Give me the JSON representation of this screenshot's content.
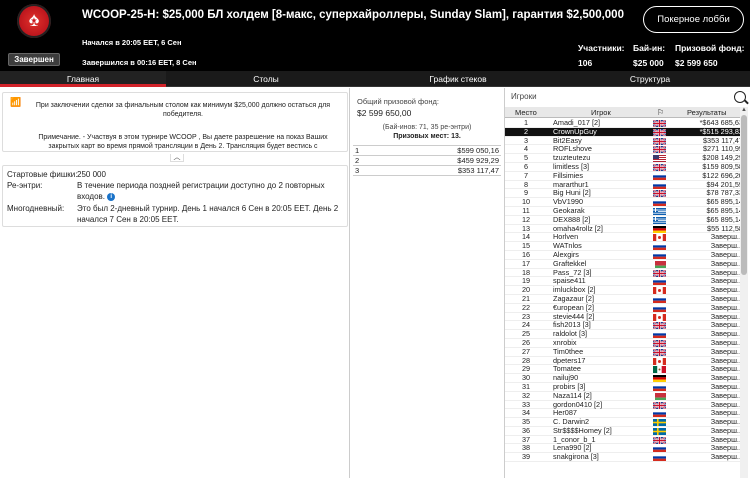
{
  "header": {
    "title": "WCOOP-25-H: $25,000 БЛ холдем [8-макс, суперхайроллеры, Sunday Slam], гарантия $2,500,000",
    "status": "Завершен",
    "started": "Начался в 20:05 EET, 6 Сен",
    "ended": "Завершился в 00:16 EET, 8 Сен",
    "lobby_button": "Покерное лобби",
    "stats": {
      "participants_label": "Участники:",
      "participants_value": "106",
      "buyin_label": "Бай-ин:",
      "buyin_value": "$25 000",
      "prize_label": "Призовой фонд:",
      "prize_value": "$2 599 650"
    }
  },
  "tabs": [
    "Главная",
    "Столы",
    "График стеков",
    "Структура"
  ],
  "notice": {
    "line1": "При заключении сделки за финальным столом как минимум $25,000 должно остаться для победителя.",
    "line2": "Примечание. - Участвуя в этом турнире WCOOP , Вы даете разрешение на показ Ваших закрытых карт во время прямой трансляции в День 2. Трансляция будет вестись с"
  },
  "info": {
    "chips_label": "Стартовые фишки:",
    "chips_value": "250 000",
    "reentry_label": "Ре-энтри:",
    "reentry_value": "В течение периода поздней регистрации доступно до 2 повторных входов.",
    "multiday_label": "Многодневный:",
    "multiday_value": "Это был 2-дневный турнир. День 1 начался 6 Сен в 20:05 EET. День 2 начался 7 Сен в 20:05 EET."
  },
  "prize": {
    "pool_label": "Общий призовой фонд:",
    "pool_value": "$2 599 650,00",
    "buyins_note": "(Бай-инов: 71, 35 ре-энтри)",
    "places_note": "Призовых мест: 13.",
    "rows": [
      {
        "place": "1",
        "amount": "$599 050,16"
      },
      {
        "place": "2",
        "amount": "$459 929,29"
      },
      {
        "place": "3",
        "amount": "$353 117,47"
      }
    ]
  },
  "players": {
    "label": "Игроки",
    "headers": {
      "place": "Место",
      "player": "Игрок",
      "results": "Результаты"
    },
    "rows": [
      {
        "place": "1",
        "name": "Amadi_017 [2]",
        "result": "*$643 685,63",
        "flag": "gb"
      },
      {
        "place": "2",
        "name": "CrownUpGuy",
        "result": "*$515 293,82",
        "flag": "gb"
      },
      {
        "place": "3",
        "name": "Bit2Easy",
        "result": "$353 117,47",
        "flag": "gb"
      },
      {
        "place": "4",
        "name": "ROFLshove",
        "result": "$271 110,99",
        "flag": "gb"
      },
      {
        "place": "5",
        "name": "tzuzteutezu",
        "result": "$208 149,29",
        "flag": "us"
      },
      {
        "place": "6",
        "name": "limitless [3]",
        "result": "$159 809,58",
        "flag": "gb"
      },
      {
        "place": "7",
        "name": "Fillsimies",
        "result": "$122 696,20",
        "flag": "ru"
      },
      {
        "place": "8",
        "name": "mararthur1",
        "result": "$94 201,59",
        "flag": "ru"
      },
      {
        "place": "9",
        "name": "Big Huni [2]",
        "result": "$78 787,33",
        "flag": "gb"
      },
      {
        "place": "10",
        "name": "VbV1990",
        "result": "$65 895,14",
        "flag": "ru"
      },
      {
        "place": "11",
        "name": "Geokarak",
        "result": "$65 895,14",
        "flag": "gr"
      },
      {
        "place": "12",
        "name": "DEX888 [2]",
        "result": "$65 895,14",
        "flag": "gr"
      },
      {
        "place": "13",
        "name": "omaha4rollz [2]",
        "result": "$55 112,58",
        "flag": "de"
      },
      {
        "place": "14",
        "name": "Horlven",
        "result": "Заверш...",
        "flag": "ca"
      },
      {
        "place": "15",
        "name": "WATnlos",
        "result": "Заверш...",
        "flag": "ru"
      },
      {
        "place": "16",
        "name": "Alexgirs",
        "result": "Заверш...",
        "flag": "ru"
      },
      {
        "place": "17",
        "name": "Graftekkel",
        "result": "Заверш...",
        "flag": "by"
      },
      {
        "place": "18",
        "name": "Pass_72 [3]",
        "result": "Заверш...",
        "flag": "gb"
      },
      {
        "place": "19",
        "name": "spaise411",
        "result": "Заверш...",
        "flag": "ru"
      },
      {
        "place": "20",
        "name": "imluckbox [2]",
        "result": "Заверш...",
        "flag": "ca"
      },
      {
        "place": "21",
        "name": "Zagazaur [2]",
        "result": "Заверш...",
        "flag": "ru"
      },
      {
        "place": "22",
        "name": "€uropean [2]",
        "result": "Заверш...",
        "flag": "ru"
      },
      {
        "place": "23",
        "name": "stevie444 [2]",
        "result": "Заверш...",
        "flag": "ca"
      },
      {
        "place": "24",
        "name": "fish2013 [3]",
        "result": "Заверш...",
        "flag": "gb"
      },
      {
        "place": "25",
        "name": "raldolot [3]",
        "result": "Заверш...",
        "flag": "ru"
      },
      {
        "place": "26",
        "name": "xnrobix",
        "result": "Заверш...",
        "flag": "gb"
      },
      {
        "place": "27",
        "name": "Tim0thee",
        "result": "Заверш...",
        "flag": "gb"
      },
      {
        "place": "28",
        "name": "dpeters17",
        "result": "Заверш...",
        "flag": "ca"
      },
      {
        "place": "29",
        "name": "Tomatee",
        "result": "Заверш...",
        "flag": "mx"
      },
      {
        "place": "30",
        "name": "nailuj90",
        "result": "Заверш...",
        "flag": "de"
      },
      {
        "place": "31",
        "name": "probirs [3]",
        "result": "Заверш...",
        "flag": "ru"
      },
      {
        "place": "32",
        "name": "Naza114 [2]",
        "result": "Заверш...",
        "flag": "by"
      },
      {
        "place": "33",
        "name": "gordon0410 [2]",
        "result": "Заверш...",
        "flag": "gb"
      },
      {
        "place": "34",
        "name": "Her087",
        "result": "Заверш...",
        "flag": "ru"
      },
      {
        "place": "35",
        "name": "C. Darwin2",
        "result": "Заверш...",
        "flag": "se"
      },
      {
        "place": "36",
        "name": "Str$$$$Homey [2]",
        "result": "Заверш...",
        "flag": "se"
      },
      {
        "place": "37",
        "name": "1_conor_b_1",
        "result": "Заверш...",
        "flag": "gb"
      },
      {
        "place": "38",
        "name": "Lena990 [2]",
        "result": "Заверш...",
        "flag": "ru"
      },
      {
        "place": "39",
        "name": "snakgirona [3]",
        "result": "Заверш...",
        "flag": "ru"
      }
    ]
  },
  "colors": {
    "accent": "#d2232a",
    "header_bg": "#000000",
    "selected_row": "#111111"
  }
}
